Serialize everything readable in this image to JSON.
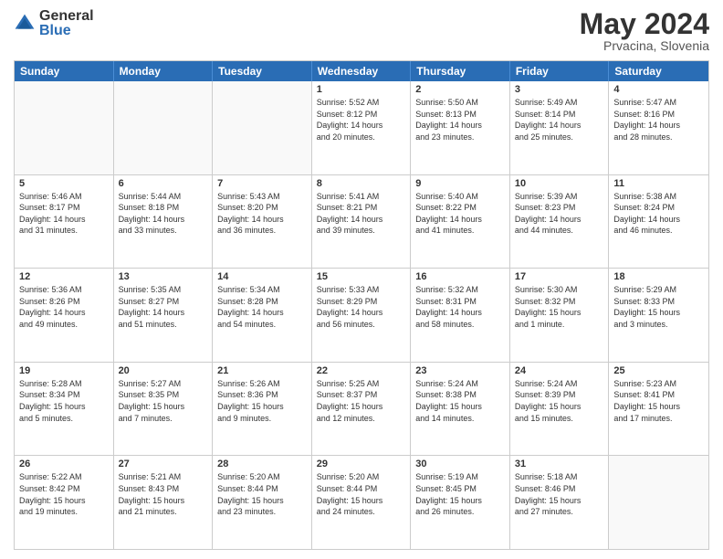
{
  "logo": {
    "general": "General",
    "blue": "Blue"
  },
  "title": "May 2024",
  "location": "Prvacina, Slovenia",
  "days": [
    "Sunday",
    "Monday",
    "Tuesday",
    "Wednesday",
    "Thursday",
    "Friday",
    "Saturday"
  ],
  "weeks": [
    [
      {
        "day": "",
        "content": ""
      },
      {
        "day": "",
        "content": ""
      },
      {
        "day": "",
        "content": ""
      },
      {
        "day": "1",
        "content": "Sunrise: 5:52 AM\nSunset: 8:12 PM\nDaylight: 14 hours\nand 20 minutes."
      },
      {
        "day": "2",
        "content": "Sunrise: 5:50 AM\nSunset: 8:13 PM\nDaylight: 14 hours\nand 23 minutes."
      },
      {
        "day": "3",
        "content": "Sunrise: 5:49 AM\nSunset: 8:14 PM\nDaylight: 14 hours\nand 25 minutes."
      },
      {
        "day": "4",
        "content": "Sunrise: 5:47 AM\nSunset: 8:16 PM\nDaylight: 14 hours\nand 28 minutes."
      }
    ],
    [
      {
        "day": "5",
        "content": "Sunrise: 5:46 AM\nSunset: 8:17 PM\nDaylight: 14 hours\nand 31 minutes."
      },
      {
        "day": "6",
        "content": "Sunrise: 5:44 AM\nSunset: 8:18 PM\nDaylight: 14 hours\nand 33 minutes."
      },
      {
        "day": "7",
        "content": "Sunrise: 5:43 AM\nSunset: 8:20 PM\nDaylight: 14 hours\nand 36 minutes."
      },
      {
        "day": "8",
        "content": "Sunrise: 5:41 AM\nSunset: 8:21 PM\nDaylight: 14 hours\nand 39 minutes."
      },
      {
        "day": "9",
        "content": "Sunrise: 5:40 AM\nSunset: 8:22 PM\nDaylight: 14 hours\nand 41 minutes."
      },
      {
        "day": "10",
        "content": "Sunrise: 5:39 AM\nSunset: 8:23 PM\nDaylight: 14 hours\nand 44 minutes."
      },
      {
        "day": "11",
        "content": "Sunrise: 5:38 AM\nSunset: 8:24 PM\nDaylight: 14 hours\nand 46 minutes."
      }
    ],
    [
      {
        "day": "12",
        "content": "Sunrise: 5:36 AM\nSunset: 8:26 PM\nDaylight: 14 hours\nand 49 minutes."
      },
      {
        "day": "13",
        "content": "Sunrise: 5:35 AM\nSunset: 8:27 PM\nDaylight: 14 hours\nand 51 minutes."
      },
      {
        "day": "14",
        "content": "Sunrise: 5:34 AM\nSunset: 8:28 PM\nDaylight: 14 hours\nand 54 minutes."
      },
      {
        "day": "15",
        "content": "Sunrise: 5:33 AM\nSunset: 8:29 PM\nDaylight: 14 hours\nand 56 minutes."
      },
      {
        "day": "16",
        "content": "Sunrise: 5:32 AM\nSunset: 8:31 PM\nDaylight: 14 hours\nand 58 minutes."
      },
      {
        "day": "17",
        "content": "Sunrise: 5:30 AM\nSunset: 8:32 PM\nDaylight: 15 hours\nand 1 minute."
      },
      {
        "day": "18",
        "content": "Sunrise: 5:29 AM\nSunset: 8:33 PM\nDaylight: 15 hours\nand 3 minutes."
      }
    ],
    [
      {
        "day": "19",
        "content": "Sunrise: 5:28 AM\nSunset: 8:34 PM\nDaylight: 15 hours\nand 5 minutes."
      },
      {
        "day": "20",
        "content": "Sunrise: 5:27 AM\nSunset: 8:35 PM\nDaylight: 15 hours\nand 7 minutes."
      },
      {
        "day": "21",
        "content": "Sunrise: 5:26 AM\nSunset: 8:36 PM\nDaylight: 15 hours\nand 9 minutes."
      },
      {
        "day": "22",
        "content": "Sunrise: 5:25 AM\nSunset: 8:37 PM\nDaylight: 15 hours\nand 12 minutes."
      },
      {
        "day": "23",
        "content": "Sunrise: 5:24 AM\nSunset: 8:38 PM\nDaylight: 15 hours\nand 14 minutes."
      },
      {
        "day": "24",
        "content": "Sunrise: 5:24 AM\nSunset: 8:39 PM\nDaylight: 15 hours\nand 15 minutes."
      },
      {
        "day": "25",
        "content": "Sunrise: 5:23 AM\nSunset: 8:41 PM\nDaylight: 15 hours\nand 17 minutes."
      }
    ],
    [
      {
        "day": "26",
        "content": "Sunrise: 5:22 AM\nSunset: 8:42 PM\nDaylight: 15 hours\nand 19 minutes."
      },
      {
        "day": "27",
        "content": "Sunrise: 5:21 AM\nSunset: 8:43 PM\nDaylight: 15 hours\nand 21 minutes."
      },
      {
        "day": "28",
        "content": "Sunrise: 5:20 AM\nSunset: 8:44 PM\nDaylight: 15 hours\nand 23 minutes."
      },
      {
        "day": "29",
        "content": "Sunrise: 5:20 AM\nSunset: 8:44 PM\nDaylight: 15 hours\nand 24 minutes."
      },
      {
        "day": "30",
        "content": "Sunrise: 5:19 AM\nSunset: 8:45 PM\nDaylight: 15 hours\nand 26 minutes."
      },
      {
        "day": "31",
        "content": "Sunrise: 5:18 AM\nSunset: 8:46 PM\nDaylight: 15 hours\nand 27 minutes."
      },
      {
        "day": "",
        "content": ""
      }
    ]
  ]
}
